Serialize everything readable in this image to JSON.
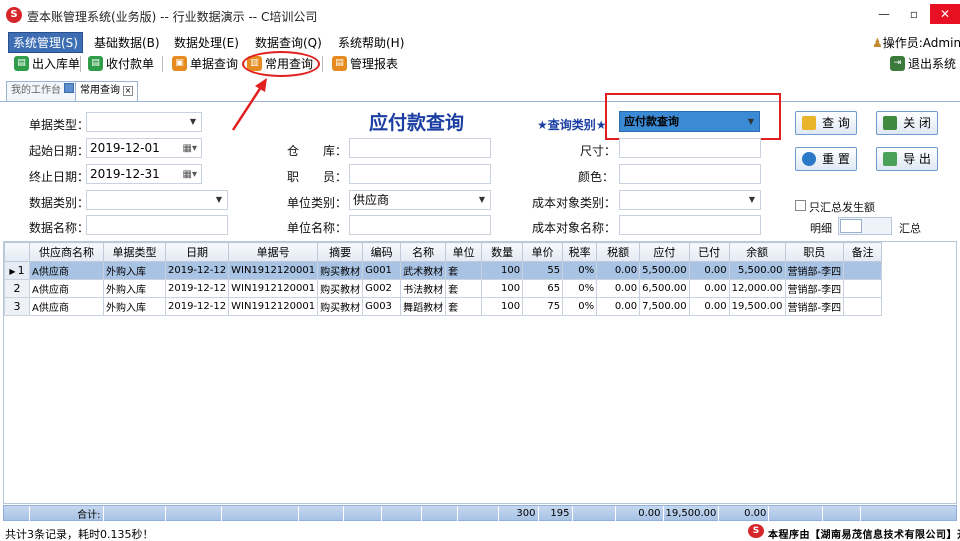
{
  "window": {
    "title": "壹本账管理系统(业务版) -- 行业数据演示 -- C培训公司",
    "logo_glyph": "S"
  },
  "menu": {
    "items": [
      "系统管理(S)",
      "基础数据(B)",
      "数据处理(E)",
      "数据查询(Q)",
      "系统帮助(H)"
    ],
    "operator": "操作员:Admin"
  },
  "toolbar": {
    "items": [
      {
        "label": "出入库单",
        "icon": "stock-doc-icon",
        "color": "#2f9d4a"
      },
      {
        "label": "收付款单",
        "icon": "payment-doc-icon",
        "color": "#2f9d4a"
      },
      {
        "label": "单据查询",
        "icon": "doc-search-icon",
        "color": "#e58b1f"
      },
      {
        "label": "常用查询",
        "icon": "chart-query-icon",
        "color": "#e58b1f"
      },
      {
        "label": "管理报表",
        "icon": "report-icon",
        "color": "#e58b1f"
      }
    ],
    "exit_label": "退出系统"
  },
  "tabs": {
    "workbench": "我的工作台",
    "query": "常用查询"
  },
  "form": {
    "heading": "应付款查询",
    "doc_type_label": "单据类型：",
    "doc_type_value": "",
    "start_date_label": "起始日期：",
    "start_date_value": "2019-12-01",
    "end_date_label": "终止日期：",
    "end_date_value": "2019-12-31",
    "data_category_label": "数据类别：",
    "data_category_value": "",
    "data_name_label": "数据名称：",
    "data_name_value": "",
    "warehouse_label": "仓　　库：",
    "warehouse_value": "",
    "staff_label": "职　　员：",
    "staff_value": "",
    "unit_type_label": "单位类别：",
    "unit_type_value": "供应商",
    "unit_name_label": "单位名称：",
    "unit_name_value": "",
    "query_type_label": "★查询类别★",
    "query_type_value": "应付款查询",
    "size_label": "尺寸：",
    "size_value": "",
    "color_label": "颜色：",
    "color_value": "",
    "cost_type_label": "成本对象类别：",
    "cost_type_value": "",
    "cost_name_label": "成本对象名称：",
    "cost_name_value": "",
    "summary_only_label": "只汇总发生额",
    "detail_label": "明细",
    "summary_label": "汇总"
  },
  "buttons": {
    "query": "查 询",
    "close": "关 闭",
    "reset": "重 置",
    "export": "导 出"
  },
  "table": {
    "columns": [
      "供应商名称",
      "单据类型",
      "日期",
      "单据号",
      "摘要",
      "编码",
      "名称",
      "单位",
      "数量",
      "单价",
      "税率",
      "税额",
      "应付",
      "已付",
      "余额",
      "职员",
      "备注"
    ],
    "rows": [
      {
        "n": "1",
        "cells": [
          "A供应商",
          "外购入库",
          "2019-12-12",
          "WIN1912120001",
          "购买教材",
          "G001",
          "武术教材",
          "套",
          "100",
          "55",
          "0%",
          "0.00",
          "5,500.00",
          "0.00",
          "5,500.00",
          "营销部-李四",
          ""
        ]
      },
      {
        "n": "2",
        "cells": [
          "A供应商",
          "外购入库",
          "2019-12-12",
          "WIN1912120001",
          "购买教材",
          "G002",
          "书法教材",
          "套",
          "100",
          "65",
          "0%",
          "0.00",
          "6,500.00",
          "0.00",
          "12,000.00",
          "营销部-李四",
          ""
        ]
      },
      {
        "n": "3",
        "cells": [
          "A供应商",
          "外购入库",
          "2019-12-12",
          "WIN1912120001",
          "购买教材",
          "G003",
          "舞蹈教材",
          "套",
          "100",
          "75",
          "0%",
          "0.00",
          "7,500.00",
          "0.00",
          "19,500.00",
          "营销部-李四",
          ""
        ]
      }
    ],
    "selected_row": 1,
    "row_marker": "▶"
  },
  "totals": {
    "label": "合计:",
    "quantity": "300",
    "unit_price": "195",
    "tax": "0.00",
    "payable": "19,500.00",
    "paid": "0.00"
  },
  "status": {
    "text": "共计3条记录，耗时0.135秒！",
    "brand": "本程序由【湖南易茂信息技术有限公司】开发"
  },
  "colors": {
    "accent": "#3d6eb4",
    "heading": "#1b3ea3",
    "annotation": "#e02020",
    "selected_row": "#a9c3e4"
  }
}
